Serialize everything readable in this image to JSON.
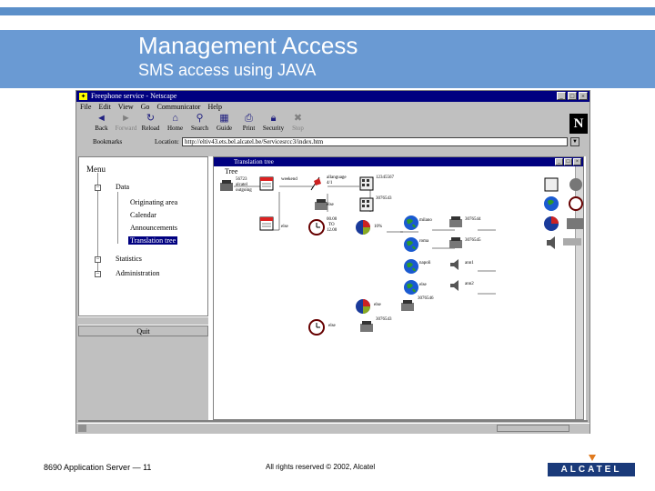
{
  "slide": {
    "title": "Management  Access",
    "subtitle": "SMS access using JAVA",
    "footer_left": "8690 Application Server — 11",
    "footer_center": "All rights reserved © 2002, Alcatel",
    "logo_text": "ALCATEL",
    "band_color": "#6a9ad3"
  },
  "browser": {
    "title": "Freephone service - Netscape",
    "window_buttons": [
      "_",
      "□",
      "×"
    ],
    "menus": [
      "File",
      "Edit",
      "View",
      "Go",
      "Communicator",
      "Help"
    ],
    "toolbar": [
      {
        "label": "Back",
        "icon": "back-arrow-icon",
        "disabled": false
      },
      {
        "label": "Forward",
        "icon": "forward-arrow-icon",
        "disabled": true
      },
      {
        "label": "Reload",
        "icon": "reload-icon",
        "disabled": false
      },
      {
        "label": "Home",
        "icon": "home-icon",
        "disabled": false
      },
      {
        "label": "Search",
        "icon": "search-icon",
        "disabled": false
      },
      {
        "label": "Guide",
        "icon": "guide-icon",
        "disabled": false
      },
      {
        "label": "Print",
        "icon": "print-icon",
        "disabled": false
      },
      {
        "label": "Security",
        "icon": "lock-icon",
        "disabled": false
      },
      {
        "label": "Stop",
        "icon": "stop-icon",
        "disabled": true
      }
    ],
    "bookmarks_label": "Bookmarks",
    "location_label": "Location:",
    "url": "http://eltiv43.ets.bel.alcatel.be/Servicesrcc3/index.htm",
    "logo_letter": "N"
  },
  "menu_frame": {
    "title": "Menu",
    "items": {
      "data": "Data",
      "originating_area": "Originating area",
      "calendar": "Calendar",
      "announcements": "Announcements",
      "translation_tree": "Translation tree",
      "statistics": "Statistics",
      "administration": "Administration"
    },
    "quit": "Quit"
  },
  "translation_window": {
    "title": "Translation tree",
    "tree_label": "Tree",
    "nodes": {
      "root1": "56723",
      "root2": "alcatel",
      "root3": "outgoing",
      "weekend": "weekend",
      "else1": "else",
      "time1": "00.00",
      "time2": "TO",
      "time3": "12.00",
      "lang": "allanguage",
      "lang_val": "4/1",
      "else2": "else",
      "num1": "12345567",
      "num2": "3076543",
      "pct": "10%",
      "milano": "milano",
      "roma": "roma",
      "napoli": "napoli",
      "else3": "else",
      "n3": "3076544",
      "n4": "3076545",
      "ann1": "ann1",
      "ann2": "ann2",
      "n5": "3076546",
      "else4": "else",
      "n6": "3076543",
      "else5": "else"
    }
  }
}
